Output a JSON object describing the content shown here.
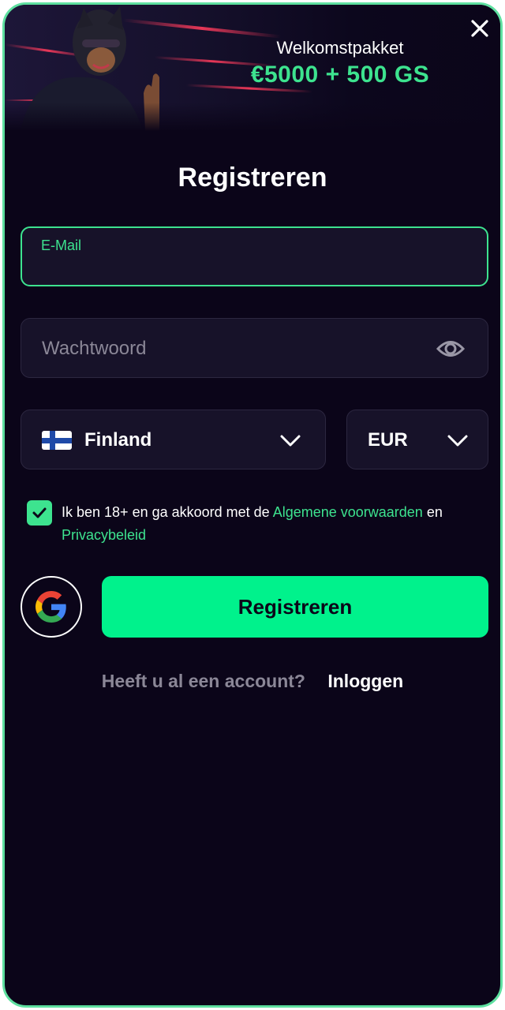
{
  "banner": {
    "title": "Welkomstpakket",
    "amount": "€5000 + 500 GS",
    "close_icon": "close-icon"
  },
  "form": {
    "heading": "Registreren",
    "email_label": "E-Mail",
    "password_placeholder": "Wachtwoord",
    "password_icon": "eye-icon",
    "country": "Finland",
    "country_flag_icon": "finland-flag-icon",
    "currency": "EUR",
    "consent_checked": true,
    "terms_prefix": "Ik ben 18+ en ga akkoord met de",
    "terms_link": "Algemene voorwaarden",
    "terms_mid": "en",
    "privacy_link": "Privacybeleid",
    "social_icon": "google-icon",
    "submit_label": "Registreren"
  },
  "footer": {
    "question": "Heeft u al een account?",
    "login_label": "Inloggen"
  },
  "colors": {
    "accent": "#3de38f",
    "button": "#00f28c",
    "background": "#0b0519"
  }
}
